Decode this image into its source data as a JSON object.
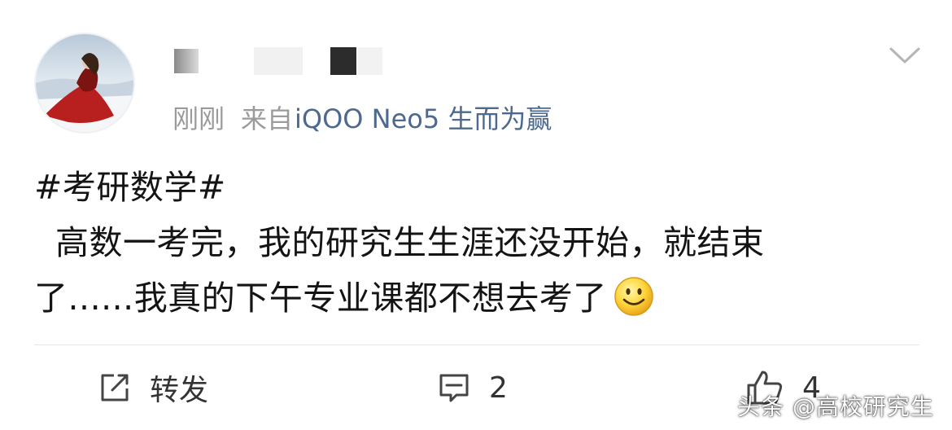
{
  "post": {
    "time": "刚刚",
    "source_prefix": "来自",
    "device": "iQOO Neo5 生而为赢",
    "hashtag": "#考研数学#",
    "line2": "高数一考完，我的研究生生涯还没开始，就结束",
    "line3": "了......我真的下午专业课都不想去考了"
  },
  "actions": {
    "repost_label": "转发",
    "comment_count": "2",
    "like_count": "4"
  },
  "watermark": "头条 @高校研究生",
  "colors": {
    "link_blue": "#4d6a8e",
    "meta_gray": "#9b9b9b",
    "text": "#141414"
  },
  "icons": [
    "chevron-down-icon",
    "repost-icon",
    "comment-icon",
    "like-icon",
    "smiley-emoji-icon"
  ]
}
